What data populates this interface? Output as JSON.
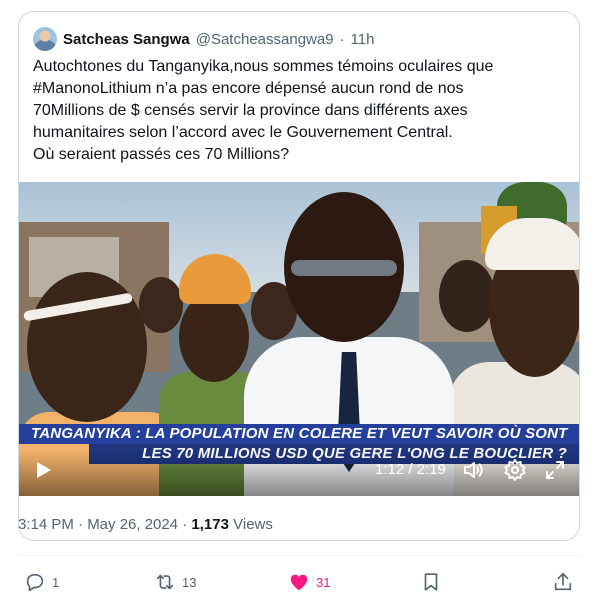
{
  "tweet": {
    "display_name": "Satcheas Sangwa",
    "handle": "@Satcheassangwa9",
    "separator": "·",
    "time": "11h",
    "text_lines": [
      "Autochtones du Tanganyika,nous sommes témoins oculaires que",
      "#ManonoLithium n’a pas encore dépensé aucun rond de nos",
      "70Millions de $ censés servir la province dans différents axes",
      "humanitaires selon l’accord avec le Gouvernement Central.",
      "Où seraient passés ces 70 Millions?"
    ]
  },
  "video": {
    "banner_line_1": "TANGANYIKA : LA POPULATION EN COLERE ET VEUT SAVOIR OÙ SONT",
    "banner_line_2": "LES 70 MILLIONS USD QUE GERE L'ONG LE BOUCLIER ?",
    "time_display": "1:12 / 2:19",
    "icons": [
      "play-icon",
      "volume-icon",
      "settings-gear-icon",
      "fullscreen-icon"
    ]
  },
  "meta": {
    "timestamp": "3:14 PM · May 26, 2024 ·",
    "views_count": "1,173",
    "views_label": "Views"
  },
  "actions": {
    "reply_count": "1",
    "retweet_count": "13",
    "like_count": "31"
  },
  "colors": {
    "text_primary": "#0f1419",
    "text_secondary": "#536471",
    "border": "#cfd9de",
    "like_pink": "#f91880",
    "banner_blue": "#243f9c"
  }
}
